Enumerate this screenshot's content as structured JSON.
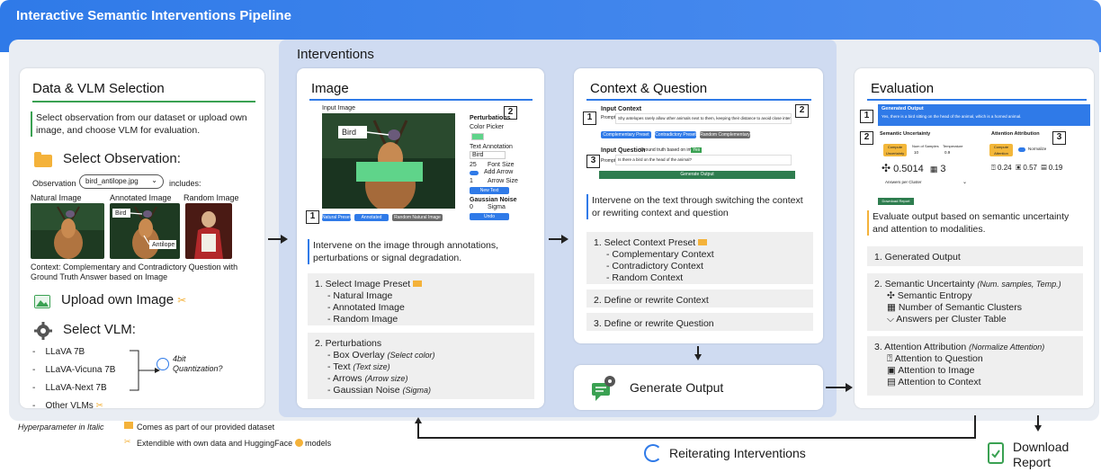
{
  "banner": {
    "title": "Interactive Semantic Interventions Pipeline"
  },
  "interventions_title": "Interventions",
  "data_vlm": {
    "title": "Data & VLM Selection",
    "desc": "Select observation from our dataset or upload own image, and choose VLM for evaluation.",
    "select_observation": "Select Observation:",
    "observation_label": "Observation",
    "observation_value": "bird_antilope.jpg",
    "includes_label": "includes:",
    "thumbs": [
      "Natural Image",
      "Annotated Image",
      "Random Image"
    ],
    "annot_bird": "Bird",
    "annot_antilope": "Antilope",
    "context_note": "Context: Complementary and Contradictory Question with Ground Truth Answer based on Image",
    "upload": "Upload own Image",
    "select_vlm": "Select VLM:",
    "vlms": [
      "LLaVA 7B",
      "LLaVA-Vicuna 7B",
      "LLaVA-Next 7B",
      "Other VLMs"
    ],
    "quant": "4bit Quantization?"
  },
  "image_card": {
    "title": "Image",
    "input_image_label": "Input Image",
    "bird_label": "Bird",
    "perturbations_label": "Perturbations",
    "color_picker": "Color Picker",
    "text_annotation": "Text Annotation",
    "text_annotation_value": "Bird",
    "font_size": "Font Size",
    "font_size_value": "25",
    "add_arrow": "Add Arrow",
    "arrow_size": "Arrow Size",
    "arrow_size_value": "1",
    "new_text": "New Text",
    "gaussian_noise": "Gaussian Noise",
    "sigma": "Sigma",
    "sigma_value": "0",
    "undo": "Undo",
    "preset_buttons": [
      "Natural Preset",
      "Annotated Preset",
      "Random Natural Image"
    ],
    "desc": "Intervene on the image through annotations, perturbations or signal degradation.",
    "list1_title": "1.  Select Image Preset",
    "list1_items": [
      "- Natural Image",
      "- Annotated Image",
      "- Random Image"
    ],
    "list2_title": "2.  Perturbations",
    "list2_items": [
      {
        "text": "- Box Overlay",
        "hyper": "(Select color)"
      },
      {
        "text": "- Text",
        "hyper": "(Text size)"
      },
      {
        "text": "- Arrows",
        "hyper": "(Arrow size)"
      },
      {
        "text": "- Gaussian Noise",
        "hyper": "(Sigma)"
      }
    ]
  },
  "context_card": {
    "title": "Context & Question",
    "input_context": "Input Context",
    "prompt_label": "Prompt",
    "context_text": "Shy antelopes rarely allow other animals next to them, keeping their distance to avoid close interactions.",
    "preset_buttons": [
      "Complementary Preset",
      "Contradictory Preset",
      "Random Complementary Text"
    ],
    "input_question": "Input Question",
    "ground_truth": "Ground truth based on image:",
    "ground_truth_value": "Yes",
    "question_text": "Is there a bird on the head of the animal?",
    "generate_btn": "Generate Output",
    "desc": "Intervene on the text through switching the context or rewriting context and question",
    "list1_title": "1.  Select Context Preset",
    "list1_items": [
      "- Complementary Context",
      "- Contradictory Context",
      "- Random Context"
    ],
    "list2": "2.  Define or rewrite Context",
    "list3": "3.  Define or rewrite Question"
  },
  "generate_output": {
    "label": "Generate Output"
  },
  "evaluation": {
    "title": "Evaluation",
    "generated_output": "Generated Output",
    "generated_text": "Yes, there is a bird sitting on the head of the animal, which is a horned animal.",
    "semantic_uncertainty": "Semantic Uncertainty",
    "attention_attribution": "Attention Attribution",
    "compute_uncertainty": "Compute Uncertainty",
    "num_samples": "Num of Samples",
    "num_samples_value": "10",
    "temperature": "Temperature",
    "temperature_value": "0.9",
    "compute_attention": "Compute Attention",
    "normalize": "Normalize",
    "entropy_value": "0.5014",
    "clusters_value": "3",
    "answers_per_cluster": "Answers per Cluster",
    "att_q": "0.24",
    "att_img": "0.57",
    "att_ctx": "0.19",
    "download_small": "Download Report",
    "desc": "Evaluate output based on semantic uncertainty and attention to modalities.",
    "list1": "1.  Generated Output",
    "list2_title": "2.  Semantic Uncertainty",
    "list2_hyper": "(Num. samples, Temp.)",
    "list2_items": [
      "Semantic Entropy",
      "Number of Semantic Clusters",
      "Answers per Cluster Table"
    ],
    "list3_title": "3.  Attention Attribution",
    "list3_hyper": "(Normalize Attention)",
    "list3_items": [
      "Attention to Question",
      "Attention to Image",
      "Attention to Context"
    ]
  },
  "footer": {
    "hyper_note": "Hyperparameter in Italic",
    "dataset_note": "Comes as part of our provided dataset",
    "extend_note": "Extendible with own data and HuggingFace",
    "extend_note_tail": "models",
    "reiterating": "Reiterating Interventions",
    "download": "Download",
    "report": "Report"
  },
  "colors": {
    "blue": "#2f7ae8",
    "green": "#3aa152",
    "orange": "#f4b23a",
    "frame": "#e9edf3"
  }
}
